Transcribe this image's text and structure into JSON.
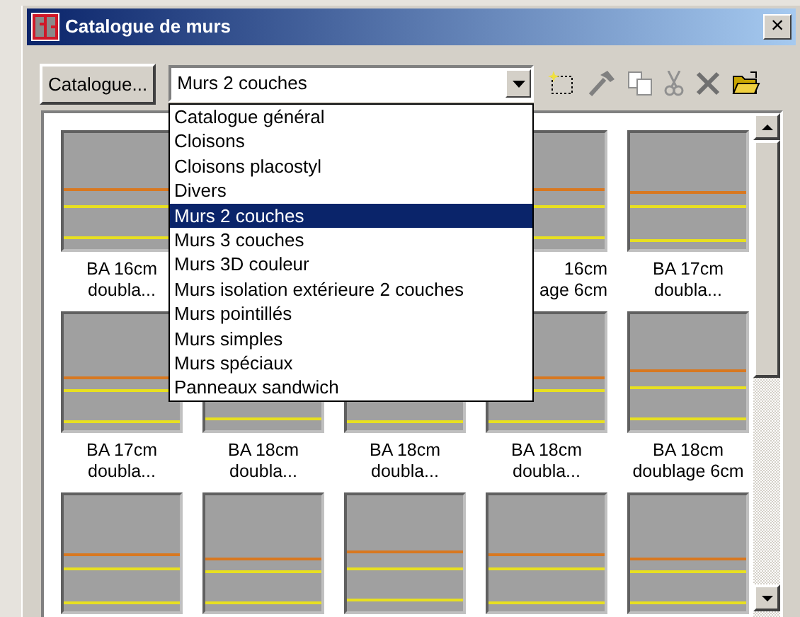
{
  "window": {
    "title": "Catalogue de murs",
    "close": "×"
  },
  "toolbar": {
    "catalogue_button": "Catalogue...",
    "combo_value": "Murs 2 couches",
    "combo_open": true
  },
  "dropdown": [
    {
      "label": "Catalogue général",
      "selected": false
    },
    {
      "label": "Cloisons",
      "selected": false
    },
    {
      "label": "Cloisons placostyl",
      "selected": false
    },
    {
      "label": "Divers",
      "selected": false
    },
    {
      "label": "Murs 2 couches",
      "selected": true
    },
    {
      "label": "Murs 3 couches",
      "selected": false
    },
    {
      "label": "Murs 3D couleur",
      "selected": false
    },
    {
      "label": "Murs isolation extérieure 2 couches",
      "selected": false
    },
    {
      "label": "Murs pointillés",
      "selected": false
    },
    {
      "label": "Murs simples",
      "selected": false
    },
    {
      "label": "Murs spéciaux",
      "selected": false
    },
    {
      "label": "Panneaux sandwich",
      "selected": false
    }
  ],
  "tiles": [
    {
      "kind": "wall",
      "label": [
        "BA 16cm",
        "doubla..."
      ]
    },
    {
      "kind": "covered"
    },
    {
      "kind": "covered"
    },
    {
      "kind": "wall",
      "label": [
        "16cm",
        "age 6cm"
      ],
      "partly_covered": true
    },
    {
      "kind": "wall",
      "label": [
        "BA 17cm",
        "doubla..."
      ]
    },
    {
      "kind": "wall",
      "label": [
        "BA 17cm",
        "doubla..."
      ]
    },
    {
      "kind": "wall",
      "label": [
        "BA 18cm",
        "doubla..."
      ]
    },
    {
      "kind": "wall",
      "label": [
        "BA 18cm",
        "doubla..."
      ]
    },
    {
      "kind": "wall",
      "label": [
        "BA 18cm",
        "doubla..."
      ]
    },
    {
      "kind": "wall",
      "label": [
        "BA 18cm",
        "doublage 6cm"
      ]
    },
    {
      "kind": "wall"
    },
    {
      "kind": "wall"
    },
    {
      "kind": "wall"
    },
    {
      "kind": "wall"
    },
    {
      "kind": "wall"
    }
  ]
}
